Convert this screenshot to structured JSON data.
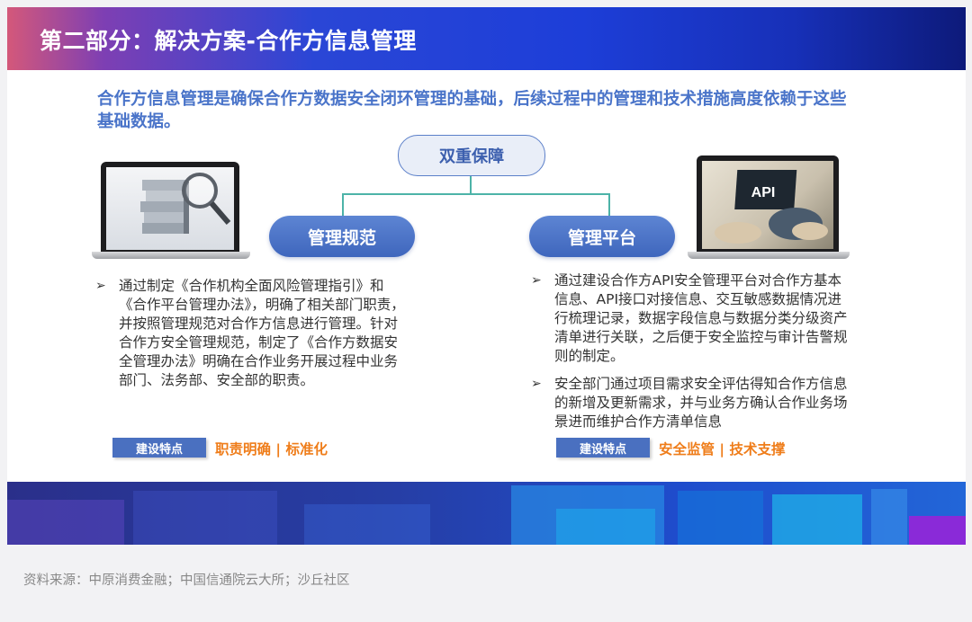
{
  "title": "第二部分：解决方案-合作方信息管理",
  "intro": "合作方信息管理是确保合作方数据安全闭环管理的基础，后续过程中的管理和技术措施高度依赖于这些基础数据。",
  "center_label": "双重保障",
  "left": {
    "pill": "管理规范",
    "bullets": [
      "通过制定《合作机构全面风险管理指引》和《合作平台管理办法》，明确了相关部门职责，并按照管理规范对合作方信息进行管理。针对合作方安全管理规范，制定了《合作方数据安全管理办法》明确在合作业务开展过程中业务部门、法务部、安全部的职责。"
    ],
    "tag_label": "建设特点",
    "tag_text": "职责明确 | 标准化"
  },
  "right": {
    "pill": "管理平台",
    "bullets": [
      "通过建设合作方API安全管理平台对合作方基本信息、API接口对接信息、交互敏感数据情况进行梳理记录，数据字段信息与数据分类分级资产清单进行关联，之后便于安全监控与审计告警规则的制定。",
      "安全部门通过项目需求安全评估得知合作方信息的新增及更新需求，并与业务方确认合作业务场景进而维护合作方清单信息"
    ],
    "tag_label": "建设特点",
    "tag_text": "安全监管 | 技术支撑",
    "screen_label": "API"
  },
  "bullet_marker": "➢",
  "source": "资料来源：中原消费金融；中国信通院云大所；沙丘社区",
  "colors": {
    "title_bar_start": "#d4587a",
    "title_bar_end": "#0d1a7a",
    "intro_text": "#4a74c9",
    "pill": "#4a70c0",
    "tag_text": "#ef7d1a",
    "connector": "#4db3a8"
  }
}
